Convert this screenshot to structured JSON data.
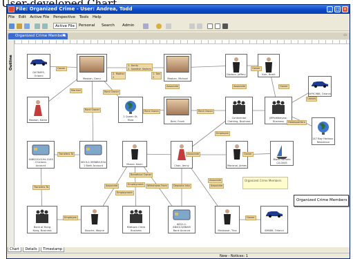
{
  "page_title": "User-developed Chart",
  "window": {
    "title": "File: Organized Crime - User: Andrea, Todd"
  },
  "menu": [
    "File",
    "Edit",
    "Active File",
    "Perspective",
    "Tools",
    "Help"
  ],
  "toolbar": {
    "active_file": "Active File",
    "personal": "Personal",
    "search": "Search",
    "admin": "Admin"
  },
  "tab": {
    "label": "Organized Crime Members",
    "close": "✖"
  },
  "outline_label": "Outline",
  "nodes": [
    {
      "id": "car1",
      "caption": "GA76495, Orlanni",
      "icon": "car-icon"
    },
    {
      "id": "m_main",
      "caption": "Maskan, Garry",
      "icon": "photo-icon"
    },
    {
      "id": "m_photo2",
      "caption": "Maskan, Michael",
      "icon": "photo-icon"
    },
    {
      "id": "m_top1",
      "caption": "Dodson, Jeffery",
      "icon": "person-suit-icon"
    },
    {
      "id": "m_top2",
      "caption": "Karr, Brent",
      "icon": "person-suit-icon"
    },
    {
      "id": "f1",
      "caption": "Maskan, Kathe",
      "icon": "person-female-icon"
    },
    {
      "id": "globe1",
      "caption": "2 Queen St,\nEliza",
      "icon": "globe-icon"
    },
    {
      "id": "m_photo3",
      "caption": "Bahl, Frank",
      "icon": "photo-icon"
    },
    {
      "id": "grp1",
      "caption": "Continental\nClothing, Business",
      "icon": "group-icon"
    },
    {
      "id": "grp2",
      "caption": "JMPoletkeyew,\nBusiness",
      "icon": "group-icon"
    },
    {
      "id": "car2",
      "caption": "NY9C986, Orlanni",
      "icon": "car-icon"
    },
    {
      "id": "globe2",
      "caption": "147 Bay Harbour,\nResidence",
      "icon": "globe-icon"
    },
    {
      "id": "card1",
      "caption": "34892010194-0183\nChickens\nAccount",
      "icon": "card-icon"
    },
    {
      "id": "card2",
      "caption": "4619-0-5EB8B0-B34\n1 Bank Account",
      "icon": "card-icon"
    },
    {
      "id": "m_mid1",
      "caption": "Mosco, Kevin",
      "icon": "person-suit-icon"
    },
    {
      "id": "f2",
      "caption": "Chan, Jenny",
      "icon": "person-female-icon"
    },
    {
      "id": "m_mid2",
      "caption": "Maconai, James",
      "icon": "person-suit-icon"
    },
    {
      "id": "boat",
      "caption": "Black Hornets\nCA-0045",
      "icon": "boat-icon"
    },
    {
      "id": "grp3",
      "caption": "Bank of Hong\nKong, Business",
      "icon": "group-icon"
    },
    {
      "id": "m_bot1",
      "caption": "Bouche, Wayne",
      "icon": "person-suit-icon"
    },
    {
      "id": "grp4",
      "caption": "Midtown Cleve\nBusiness",
      "icon": "group-icon"
    },
    {
      "id": "card3",
      "caption": "6632-0-8B4013/8BAM\nBank Account",
      "icon": "card-icon"
    },
    {
      "id": "m_bot2",
      "caption": "Meskanar, Tina",
      "icon": "person-suit-icon"
    },
    {
      "id": "car3",
      "caption": "SMK86, Orlanni",
      "icon": "car-icon"
    }
  ],
  "links": [
    {
      "text": "Owner"
    },
    {
      "text": "Married"
    },
    {
      "text": "2. Mother\n2"
    },
    {
      "text": "1. Aunty\n2. Swedish Stokers"
    },
    {
      "text": "1. Sen\n2"
    },
    {
      "text": "Associate"
    },
    {
      "text": "Associate"
    },
    {
      "text": "Owner"
    },
    {
      "text": "Rent Owner"
    },
    {
      "text": "Rent Owner"
    },
    {
      "text": "Rent Owner"
    },
    {
      "text": "Rent Owner"
    },
    {
      "text": "Employee"
    },
    {
      "text": "Owner"
    },
    {
      "text": "Leases"
    },
    {
      "text": "Headquarters"
    },
    {
      "text": "Transfers To"
    },
    {
      "text": "Transfers To"
    },
    {
      "text": "Beneficial Owner"
    },
    {
      "text": "Associate"
    },
    {
      "text": "Employment"
    },
    {
      "text": "Associate"
    },
    {
      "text": "Owner"
    },
    {
      "text": "Employee"
    },
    {
      "text": "Withdraws From"
    },
    {
      "text": "Deposits Into"
    },
    {
      "text": "Associate"
    },
    {
      "text": "Employment"
    },
    {
      "text": "Owner"
    },
    {
      "text": "Associate"
    }
  ],
  "note": "Organized Crime Members",
  "callout": "Organized Crime Members",
  "bottom_tabs": [
    "Chart",
    "Details",
    "Timestamp"
  ],
  "status": "New - Notices: 1",
  "colors": {
    "titlebar": "#0c49c8",
    "tab": "#3c6bd0",
    "link_label": "#ecd8a8",
    "note": "#fffccc"
  }
}
